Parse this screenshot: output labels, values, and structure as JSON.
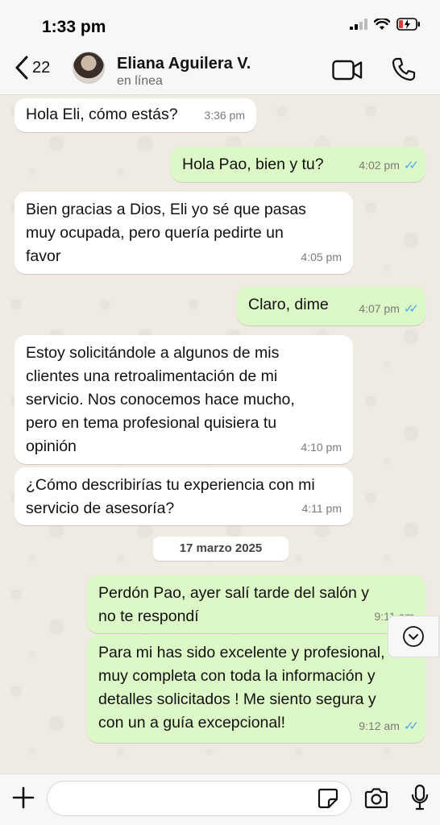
{
  "status_bar": {
    "time": "1:33 pm"
  },
  "header": {
    "back_count": "22",
    "contact_name": "Eliana Aguilera V.",
    "contact_status": "en línea"
  },
  "messages": [
    {
      "direction": "incoming",
      "lines": [
        "Hola Eli, cómo estás?"
      ],
      "time": "3:36 pm"
    },
    {
      "direction": "outgoing",
      "lines": [
        "Hola Pao, bien y tu?"
      ],
      "time": "4:02 pm",
      "read": true
    },
    {
      "direction": "incoming",
      "lines": [
        "Bien gracias a Dios, Eli yo sé que pasas",
        "muy ocupada, pero quería pedirte un",
        "favor"
      ],
      "time": "4:05 pm"
    },
    {
      "direction": "outgoing",
      "lines": [
        "Claro, dime"
      ],
      "time": "4:07 pm",
      "read": true
    },
    {
      "direction": "incoming",
      "lines": [
        "Estoy solicitándole a algunos de mis",
        "clientes una retroalimentación de mi",
        "servicio. Nos conocemos hace mucho,",
        "pero en tema profesional quisiera tu",
        "opinión"
      ],
      "time": "4:10 pm"
    },
    {
      "direction": "incoming",
      "lines": [
        "¿Cómo describirías tu experiencia con mi",
        "servicio de asesoría?"
      ],
      "time": "4:11 pm"
    },
    {
      "direction": "outgoing",
      "lines": [
        "Perdón Pao, ayer salí tarde del salón y",
        "no te respondí"
      ],
      "time": "9:11 am",
      "read": true
    },
    {
      "direction": "outgoing",
      "lines": [
        "Para mi has sido excelente y profesional,",
        "muy completa con toda la información y",
        "detalles solicitados ! Me siento segura y",
        "con un a guía excepcional!"
      ],
      "time": "9:12 am",
      "read": true
    }
  ],
  "date_separator": "17 marzo 2025",
  "composer": {
    "placeholder": ""
  },
  "colors": {
    "incoming": "#ffffff",
    "outgoing": "#dcf8c6",
    "read_ticks": "#4fa6e8"
  },
  "icons": [
    "signal-icon",
    "wifi-icon",
    "battery-charging-icon",
    "back-chevron-icon",
    "video-call-icon",
    "phone-icon",
    "scroll-down-icon",
    "plus-icon",
    "sticker-icon",
    "camera-icon",
    "microphone-icon"
  ]
}
